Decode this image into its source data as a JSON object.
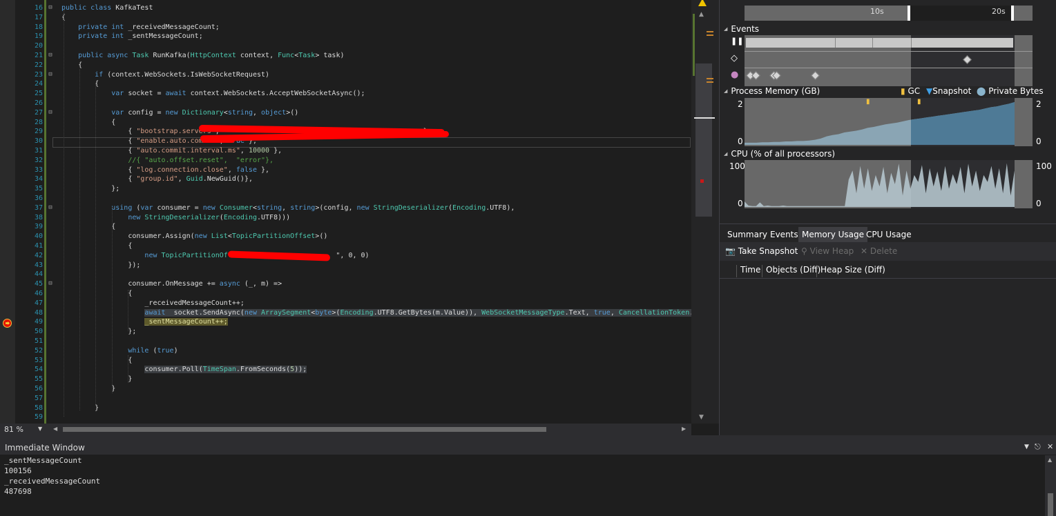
{
  "editor": {
    "line_numbers": [
      "16",
      "17",
      "18",
      "19",
      "20",
      "21",
      "22",
      "23",
      "24",
      "25",
      "26",
      "27",
      "28",
      "29",
      "30",
      "31",
      "32",
      "33",
      "34",
      "35",
      "36",
      "37",
      "38",
      "39",
      "40",
      "41",
      "42",
      "43",
      "44",
      "45",
      "46",
      "47",
      "48",
      "49",
      "50",
      "51",
      "52",
      "53",
      "54",
      "55",
      "56",
      "57",
      "58",
      "59"
    ],
    "lines": [
      [
        [
          "kw",
          "public class "
        ],
        [
          "",
          "KafkaTest"
        ]
      ],
      [
        [
          "",
          "{"
        ]
      ],
      [
        [
          "",
          "    "
        ],
        [
          "kw",
          "private int "
        ],
        [
          "",
          "_receivedMessageCount;"
        ]
      ],
      [
        [
          "",
          "    "
        ],
        [
          "kw",
          "private int "
        ],
        [
          "",
          "_sentMessageCount;"
        ]
      ],
      [
        [
          "",
          ""
        ]
      ],
      [
        [
          "",
          "    "
        ],
        [
          "kw",
          "public async "
        ],
        [
          "ty",
          "Task "
        ],
        [
          "",
          "RunKafka("
        ],
        [
          "ty",
          "HttpContext"
        ],
        [
          "",
          " context, "
        ],
        [
          "ty",
          "Func"
        ],
        [
          "",
          "<"
        ],
        [
          "ty",
          "Task"
        ],
        [
          "",
          "> task)"
        ]
      ],
      [
        [
          "",
          "    {"
        ]
      ],
      [
        [
          "",
          "        "
        ],
        [
          "kw",
          "if "
        ],
        [
          "",
          "(context.WebSockets.IsWebSocketRequest)"
        ]
      ],
      [
        [
          "",
          "        {"
        ]
      ],
      [
        [
          "",
          "            "
        ],
        [
          "kw",
          "var "
        ],
        [
          "",
          "socket = "
        ],
        [
          "kw",
          "await "
        ],
        [
          "",
          "context.WebSockets.AcceptWebSocketAsync();"
        ]
      ],
      [
        [
          "",
          ""
        ]
      ],
      [
        [
          "",
          "            "
        ],
        [
          "kw",
          "var "
        ],
        [
          "",
          "config = "
        ],
        [
          "kw",
          "new "
        ],
        [
          "ty",
          "Dictionary"
        ],
        [
          "",
          "<"
        ],
        [
          "kw",
          "string"
        ],
        [
          ",",
          ","
        ],
        [
          "kw",
          " object"
        ],
        [
          "",
          ">()"
        ]
      ],
      [
        [
          "",
          "            {"
        ]
      ],
      [
        [
          "",
          "                { "
        ],
        [
          "str",
          "\"bootstrap.servers\""
        ],
        [
          "",
          ",                                                 },"
        ]
      ],
      [
        [
          "",
          "                { "
        ],
        [
          "str",
          "\"enable.auto.commit\""
        ],
        [
          "",
          ", "
        ],
        [
          "kw",
          "true"
        ],
        [
          "",
          " },"
        ]
      ],
      [
        [
          "",
          "                { "
        ],
        [
          "str",
          "\"auto.commit.interval.ms\""
        ],
        [
          "",
          ", "
        ],
        [
          "num",
          "10000"
        ],
        [
          "",
          " },"
        ]
      ],
      [
        [
          "",
          "                "
        ],
        [
          "cm",
          "//{ \"auto.offset.reset\",  \"error\"},"
        ]
      ],
      [
        [
          "",
          "                { "
        ],
        [
          "str",
          "\"log.connection.close\""
        ],
        [
          "",
          ", "
        ],
        [
          "kw",
          "false"
        ],
        [
          "",
          " },"
        ]
      ],
      [
        [
          "",
          "                { "
        ],
        [
          "str",
          "\"group.id\""
        ],
        [
          "",
          ", "
        ],
        [
          "ty",
          "Guid"
        ],
        [
          "",
          ".NewGuid()},"
        ]
      ],
      [
        [
          "",
          "            };"
        ]
      ],
      [
        [
          "",
          ""
        ]
      ],
      [
        [
          "",
          "            "
        ],
        [
          "kw",
          "using "
        ],
        [
          "",
          "("
        ],
        [
          "kw",
          "var "
        ],
        [
          "",
          "consumer = "
        ],
        [
          "kw",
          "new "
        ],
        [
          "ty",
          "Consumer"
        ],
        [
          "",
          "<"
        ],
        [
          "kw",
          "string"
        ],
        [
          "",
          ", "
        ],
        [
          "kw",
          "string"
        ],
        [
          "",
          ">(config, "
        ],
        [
          "kw",
          "new "
        ],
        [
          "ty",
          "StringDeserializer"
        ],
        [
          "",
          "("
        ],
        [
          "ty",
          "Encoding"
        ],
        [
          "",
          ".UTF8),"
        ]
      ],
      [
        [
          "",
          "                "
        ],
        [
          "kw",
          "new "
        ],
        [
          "ty",
          "StringDeserializer"
        ],
        [
          "",
          "("
        ],
        [
          "ty",
          "Encoding"
        ],
        [
          "",
          ".UTF8)))"
        ]
      ],
      [
        [
          "",
          "            {"
        ]
      ],
      [
        [
          "",
          "                consumer.Assign("
        ],
        [
          "kw",
          "new "
        ],
        [
          "ty",
          "List"
        ],
        [
          "",
          "<"
        ],
        [
          "ty",
          "TopicPartitionOffset"
        ],
        [
          "",
          ">()"
        ]
      ],
      [
        [
          "",
          "                {"
        ]
      ],
      [
        [
          "",
          "                    "
        ],
        [
          "kw",
          "new "
        ],
        [
          "ty",
          "TopicPartitionOffset"
        ],
        [
          "",
          "(\"                    \", 0, 0)"
        ]
      ],
      [
        [
          "",
          "                });"
        ]
      ],
      [
        [
          "",
          ""
        ]
      ],
      [
        [
          "",
          "                consumer.OnMessage += "
        ],
        [
          "kw",
          "async "
        ],
        [
          "",
          "(_, m) =>"
        ]
      ],
      [
        [
          "",
          "                {"
        ]
      ],
      [
        [
          "",
          "                    _receivedMessageCount++;"
        ]
      ],
      [
        [
          "hl-start",
          "                    "
        ],
        [
          "kwh",
          "await "
        ],
        [
          "h",
          " socket.SendAsync("
        ],
        [
          "kwh",
          "new "
        ],
        [
          "tyh",
          "ArraySegment"
        ],
        [
          "h",
          "<"
        ],
        [
          "kwh",
          "byte"
        ],
        [
          "h",
          ">("
        ],
        [
          "tyh",
          "Encoding"
        ],
        [
          "h",
          ".UTF8.GetBytes(m.Value)), "
        ],
        [
          "tyh",
          "WebSocketMessageType"
        ],
        [
          "h",
          ".Text, "
        ],
        [
          "kwh",
          "true"
        ],
        [
          "h",
          ", "
        ],
        [
          "tyh",
          "CancellationToken"
        ],
        [
          "h",
          ".None);"
        ]
      ],
      [
        [
          "",
          "                    "
        ],
        [
          "cur",
          "_sentMessageCount++;"
        ]
      ],
      [
        [
          "",
          "                };"
        ]
      ],
      [
        [
          "",
          ""
        ]
      ],
      [
        [
          "",
          "                "
        ],
        [
          "kw",
          "while "
        ],
        [
          "",
          "("
        ],
        [
          "kw",
          "true"
        ],
        [
          "",
          ")"
        ]
      ],
      [
        [
          "",
          "                {"
        ]
      ],
      [
        [
          "",
          "                    "
        ],
        [
          "h",
          "consumer.Poll("
        ],
        [
          "tyh",
          "TimeSpan"
        ],
        [
          "h",
          ".FromSeconds("
        ],
        [
          "numh",
          "5"
        ],
        [
          "h",
          "));"
        ]
      ],
      [
        [
          "",
          "                }"
        ]
      ],
      [
        [
          "",
          "            }"
        ]
      ],
      [
        [
          "",
          ""
        ]
      ],
      [
        [
          "",
          "        }"
        ]
      ],
      [
        [
          "",
          ""
        ]
      ]
    ]
  },
  "status": {
    "zoom": "81 %"
  },
  "diagnostics": {
    "ruler_ticks": [
      "10s",
      "20s"
    ],
    "events_title": "Events",
    "memory_title": "Process Memory (GB)",
    "memory_legend": {
      "gc": "GC",
      "snapshot": "Snapshot",
      "private_bytes": "Private Bytes"
    },
    "memory_axis": {
      "max": "2",
      "min": "0"
    },
    "cpu_title": "CPU (% of all processors)",
    "cpu_axis": {
      "max": "100",
      "min": "0"
    },
    "tabs": [
      "Summary",
      "Events",
      "Memory Usage",
      "CPU Usage"
    ],
    "active_tab": "Memory Usage",
    "toolbar": {
      "take_snapshot": "Take Snapshot",
      "view_heap": "View Heap",
      "delete": "Delete"
    },
    "columns": [
      "Time",
      "Objects (Diff)",
      "Heap Size (Diff)"
    ],
    "colors": {
      "memory_fill": "#8aa5b4",
      "memory_dark_fill": "#4e7a96",
      "cpu_fill": "#b4c4cc",
      "panel_bg": "#686868"
    },
    "memory_series": [
      0.05,
      0.05,
      0.05,
      0.06,
      0.06,
      0.07,
      0.07,
      0.08,
      0.08,
      0.09,
      0.09,
      0.1,
      0.12,
      0.15,
      0.2,
      0.23,
      0.25,
      0.29,
      0.31,
      0.33,
      0.36,
      0.4,
      0.42,
      0.45,
      0.48,
      0.5,
      0.52,
      0.55,
      0.58,
      0.6,
      0.62,
      0.64,
      0.66,
      0.68,
      0.7,
      0.72,
      0.74,
      0.76,
      0.78,
      0.8,
      0.82,
      0.85,
      0.88,
      0.9,
      0.93,
      0.96,
      1.0
    ],
    "cpu_series": [
      12,
      3,
      2,
      2,
      10,
      2,
      3,
      2,
      2,
      2,
      3,
      2,
      2,
      2,
      2,
      2,
      2,
      2,
      2,
      2,
      2,
      2,
      2,
      2,
      2,
      2,
      2,
      60,
      80,
      30,
      90,
      40,
      85,
      35,
      70,
      45,
      88,
      30,
      75,
      50,
      95,
      25,
      80,
      40,
      70,
      55,
      92,
      30,
      85,
      45,
      78,
      35,
      90,
      40,
      72,
      50,
      88,
      30,
      95,
      45,
      80,
      35,
      70,
      55,
      90,
      40,
      85,
      30,
      96,
      25,
      80
    ]
  },
  "immediate": {
    "title": "Immediate Window",
    "lines": [
      "_sentMessageCount",
      "100156",
      "_receivedMessageCount",
      "487698"
    ]
  }
}
